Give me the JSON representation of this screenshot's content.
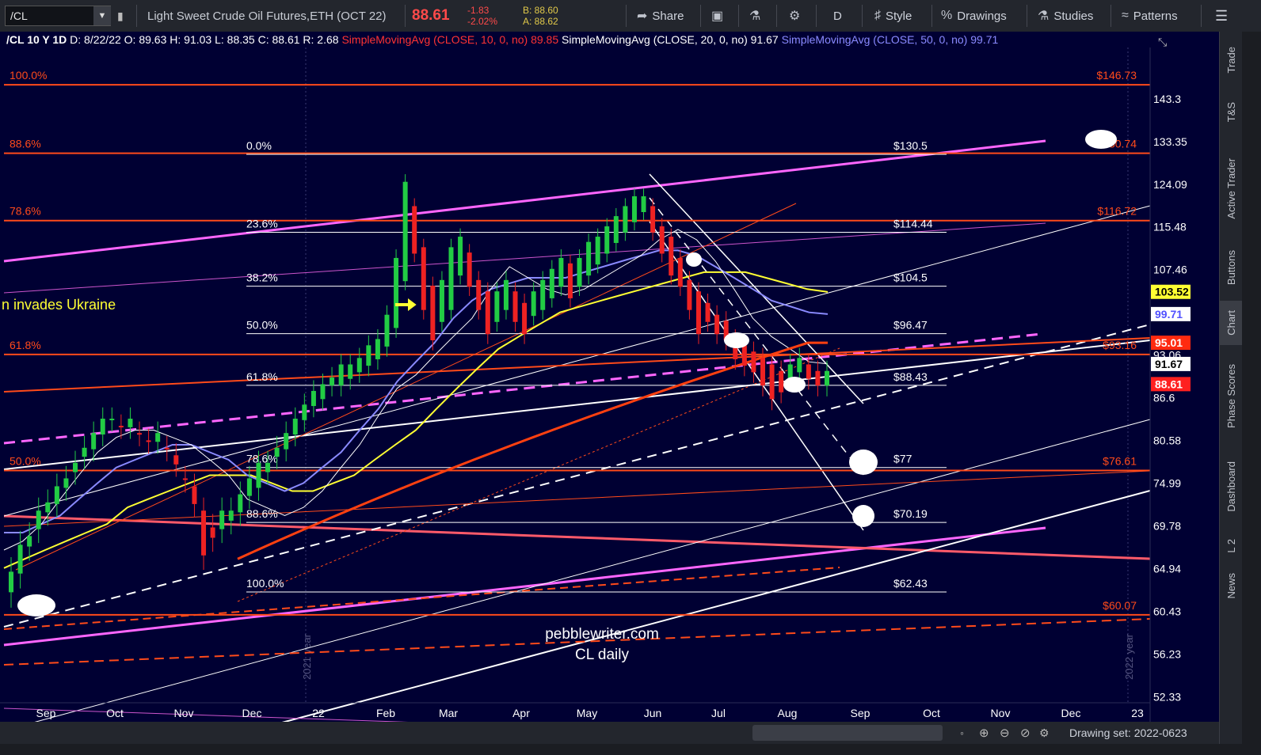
{
  "toolbar": {
    "symbol": "/CL",
    "description": "Light Sweet Crude Oil Futures,ETH (OCT 22)",
    "last": "88.61",
    "change": "-1.83",
    "change_pct": "-2.02%",
    "bid": "B: 88.60",
    "ask": "A: 88.62",
    "share": "Share",
    "aggregation": "D",
    "style": "Style",
    "drawings": "Drawings",
    "studies": "Studies",
    "patterns": "Patterns"
  },
  "side_tabs": [
    "Trade",
    "T&S",
    "Active Trader",
    "Buttons",
    "Chart",
    "Phase Scores",
    "Dashboard",
    "L 2",
    "News"
  ],
  "bottom": {
    "drawing_set": "Drawing set: 2022-0623"
  },
  "colors": {
    "background": "#000033",
    "fib_orange": "#ff4a1a",
    "magenta": "#ff66ff",
    "sma10": "#ff3030",
    "sma20": "#ffffff",
    "sma50": "#8a8aff",
    "sma100": "#ffff33",
    "sma200": "#ff4010",
    "up_candle": "#22cc44",
    "down_candle": "#ee2222"
  },
  "chart_data": {
    "type": "candlestick",
    "header": {
      "symbol_label": "/CL 10 Y 1D",
      "date": "D: 8/22/22",
      "open": "O: 89.63",
      "high": "H: 91.03",
      "low": "L: 88.35",
      "close": "C: 88.61",
      "range": "R: 2.68",
      "sma10_label": "SimpleMovingAvg (CLOSE, 10, 0, no)",
      "sma10_value": "89.85",
      "sma20_label": "SimpleMovingAvg (CLOSE, 20, 0, no)",
      "sma20_value": "91.67",
      "sma50_label": "SimpleMovingAvg (CLOSE, 50, 0, no)",
      "sma50_value": "99.71"
    },
    "y_axis": {
      "ticks": [
        "143.3",
        "133.35",
        "124.09",
        "115.48",
        "107.46",
        "93.06",
        "86.6",
        "80.58",
        "74.99",
        "69.78",
        "64.94",
        "60.43",
        "56.23",
        "52.33"
      ],
      "scale": "log",
      "range": [
        51.8,
        155.0
      ]
    },
    "x_axis": {
      "ticks": [
        "Sep",
        "Oct",
        "Nov",
        "Dec",
        "22",
        "Feb",
        "Mar",
        "Apr",
        "May",
        "Jun",
        "Jul",
        "Aug",
        "Sep",
        "Oct",
        "Nov",
        "Dec",
        "23"
      ]
    },
    "year_markers": [
      "2021 year",
      "2022 year"
    ],
    "price_tags": [
      {
        "value": "103.52",
        "bg": "#ffff33",
        "fg": "#000000"
      },
      {
        "value": "99.71",
        "bg": "#ffffff",
        "fg": "#5050ff"
      },
      {
        "value": "95.01",
        "bg": "#ff2a10",
        "fg": "#ffffff"
      },
      {
        "value": "91.67",
        "bg": "#ffffff",
        "fg": "#000000"
      },
      {
        "value": "88.61",
        "bg": "#ff2020",
        "fg": "#ffffff"
      }
    ],
    "fib_levels_long": [
      {
        "pct": "100.0%",
        "price": "$146.73",
        "value": 146.73
      },
      {
        "pct": "88.6%",
        "price": "$130.74",
        "value": 130.74
      },
      {
        "pct": "78.6%",
        "price": "$116.72",
        "value": 116.72
      },
      {
        "pct": "61.8%",
        "price": "$93.16",
        "value": 93.16
      },
      {
        "pct": "50.0%",
        "price": "$76.61",
        "value": 76.61
      },
      {
        "pct": "",
        "price": "$60.07",
        "value": 60.07
      }
    ],
    "fib_levels_short": [
      {
        "pct": "0.0%",
        "price": "$130.5",
        "value": 130.5
      },
      {
        "pct": "23.6%",
        "price": "$114.44",
        "value": 114.44
      },
      {
        "pct": "38.2%",
        "price": "$104.5",
        "value": 104.5
      },
      {
        "pct": "50.0%",
        "price": "$96.47",
        "value": 96.47
      },
      {
        "pct": "61.8%",
        "price": "$88.43",
        "value": 88.43
      },
      {
        "pct": "78.6%",
        "price": "$77",
        "value": 77
      },
      {
        "pct": "88.6%",
        "price": "$70.19",
        "value": 70.19
      },
      {
        "pct": "100.0%",
        "price": "$62.43",
        "value": 62.43
      }
    ],
    "annotations": [
      "n invades Ukraine",
      "pebblewriter.com",
      "CL daily"
    ],
    "candles_approx": [
      [
        62,
        65
      ],
      [
        64,
        68
      ],
      [
        67,
        69
      ],
      [
        69,
        72
      ],
      [
        71,
        73
      ],
      [
        72,
        75
      ],
      [
        74,
        76
      ],
      [
        76,
        78
      ],
      [
        78,
        80
      ],
      [
        79,
        82
      ],
      [
        81,
        84
      ],
      [
        83,
        84
      ],
      [
        82,
        83
      ],
      [
        82,
        84
      ],
      [
        81,
        82
      ],
      [
        80,
        81
      ],
      [
        80,
        82
      ],
      [
        79,
        80
      ],
      [
        77,
        79
      ],
      [
        75,
        76
      ],
      [
        72,
        75
      ],
      [
        66,
        72
      ],
      [
        68,
        70
      ],
      [
        69,
        72
      ],
      [
        70,
        72
      ],
      [
        71,
        74
      ],
      [
        73,
        76
      ],
      [
        74,
        78
      ],
      [
        76,
        78
      ],
      [
        78,
        80
      ],
      [
        79,
        82
      ],
      [
        81,
        84
      ],
      [
        83,
        86
      ],
      [
        85,
        88
      ],
      [
        86,
        89
      ],
      [
        88,
        90
      ],
      [
        88,
        92
      ],
      [
        89,
        92
      ],
      [
        90,
        93
      ],
      [
        91,
        95
      ],
      [
        92,
        96
      ],
      [
        94,
        100
      ],
      [
        97,
        110
      ],
      [
        105,
        125
      ],
      [
        110,
        120
      ],
      [
        100,
        112
      ],
      [
        95,
        105
      ],
      [
        98,
        106
      ],
      [
        100,
        112
      ],
      [
        106,
        114
      ],
      [
        104,
        111
      ],
      [
        100,
        106
      ],
      [
        96,
        104
      ],
      [
        98,
        104
      ],
      [
        100,
        106
      ],
      [
        98,
        104
      ],
      [
        96,
        102
      ],
      [
        99,
        104
      ],
      [
        100,
        106
      ],
      [
        102,
        108
      ],
      [
        104,
        110
      ],
      [
        102,
        109
      ],
      [
        104,
        110
      ],
      [
        106,
        113
      ],
      [
        108,
        114
      ],
      [
        110,
        116
      ],
      [
        112,
        118
      ],
      [
        114,
        120
      ],
      [
        116,
        122
      ],
      [
        118,
        122
      ],
      [
        114,
        120
      ],
      [
        110,
        116
      ],
      [
        106,
        114
      ],
      [
        104,
        110
      ],
      [
        100,
        106
      ],
      [
        96,
        104
      ],
      [
        98,
        102
      ],
      [
        96,
        100
      ],
      [
        95,
        99
      ],
      [
        92,
        96
      ],
      [
        91,
        95
      ],
      [
        90,
        94
      ],
      [
        88,
        93
      ],
      [
        86,
        92
      ],
      [
        87,
        91
      ],
      [
        89,
        92
      ],
      [
        90,
        93
      ],
      [
        89,
        92
      ],
      [
        88,
        91
      ],
      [
        88,
        91
      ]
    ],
    "sma_series_approx": {
      "sma20": [
        67,
        68,
        70,
        73,
        76,
        79,
        81,
        82,
        82,
        81,
        80,
        78,
        76,
        73,
        72,
        71,
        72,
        74,
        77,
        80,
        84,
        88,
        90,
        93,
        96,
        99,
        104,
        108,
        106,
        104,
        103,
        104,
        106,
        108,
        110,
        113,
        115,
        113,
        109,
        104,
        99,
        96,
        94,
        92,
        91.7
      ],
      "sma50": [
        69,
        69,
        70,
        71,
        73,
        75,
        77,
        78,
        79,
        80,
        80,
        79,
        78,
        76,
        75,
        74,
        75,
        77,
        79,
        82,
        85,
        89,
        92,
        95,
        99,
        102,
        104,
        105,
        106,
        106,
        106,
        107,
        108,
        109,
        110,
        111,
        111,
        110,
        108,
        106,
        104,
        102,
        101,
        100,
        99.7
      ],
      "sma100": [
        65,
        66,
        67,
        68,
        69,
        70,
        72,
        73,
        74,
        75,
        76,
        76,
        76,
        75,
        74,
        74,
        75,
        76,
        78,
        80,
        82,
        85,
        88,
        91,
        94,
        96,
        98,
        100,
        101,
        102,
        103,
        104,
        105,
        106,
        107,
        107,
        107,
        106,
        105,
        104,
        103.5
      ]
    }
  }
}
